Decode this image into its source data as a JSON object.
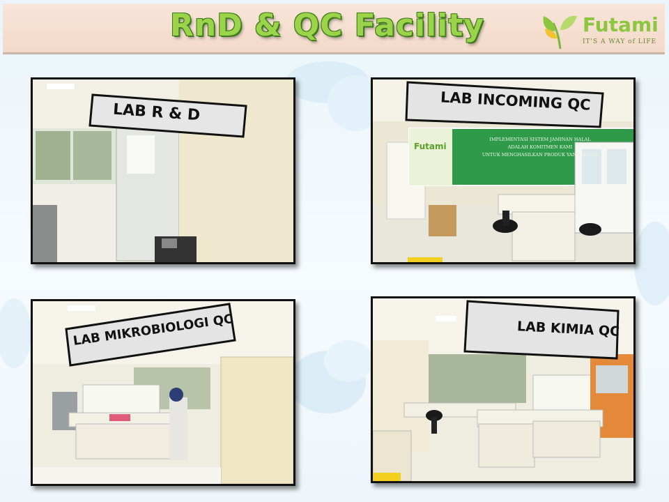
{
  "header": {
    "title": "RnD & QC Facility",
    "brand": "Futami",
    "tagline": "IT'S A WAY of LIFE"
  },
  "photos": [
    {
      "sign": "LAB R & D"
    },
    {
      "sign": "LAB INCOMING QC",
      "banner_brand": "Futami",
      "banner_lines": [
        "IMPLEMENTASI SISTEM JAMINAN HALAL",
        "ADALAH KOMITMEN KAMI",
        "UNTUK MENGHASILKAN PRODUK YANG HALAL"
      ]
    },
    {
      "sign": "LAB MIKROBIOLOGI QC"
    },
    {
      "sign": "LAB KIMIA QC"
    }
  ],
  "colors": {
    "title_green": "#9bd34a",
    "brand_green": "#8cc63f",
    "header_bg": "#f3d9c8"
  }
}
